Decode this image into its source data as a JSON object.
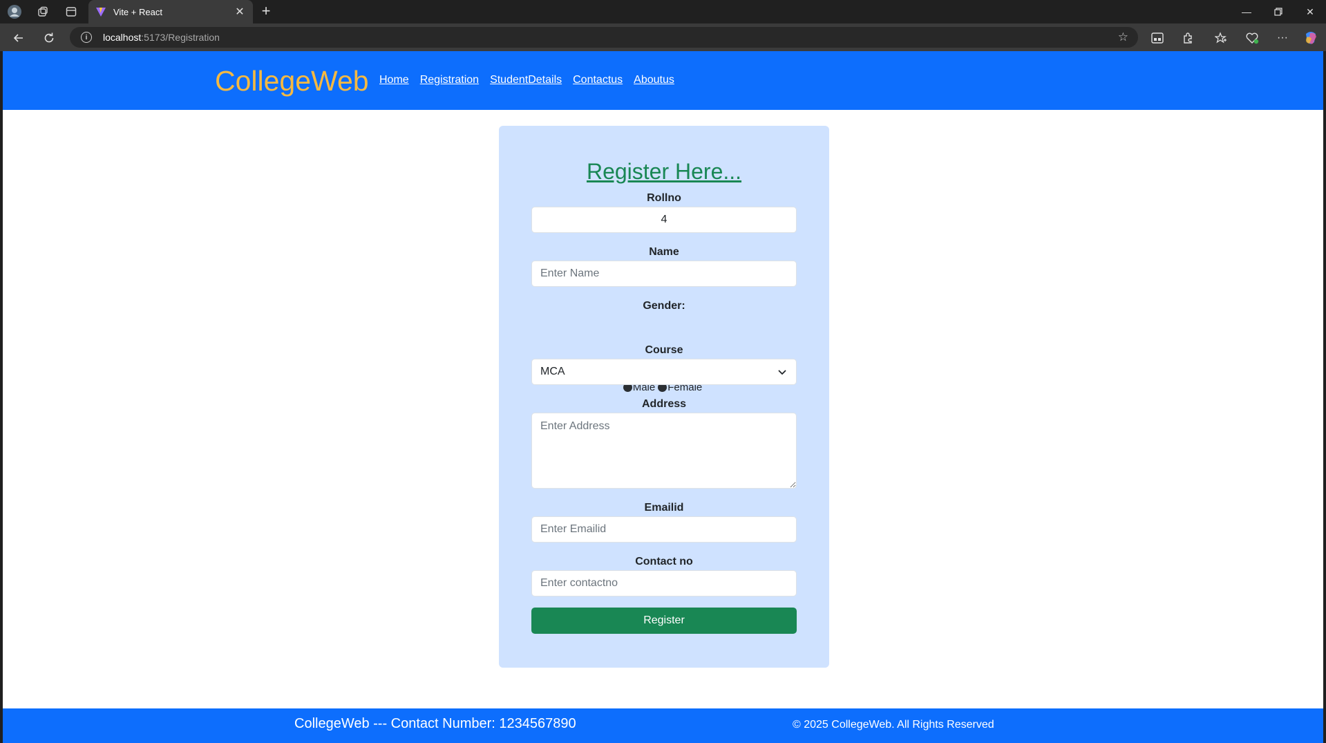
{
  "browser": {
    "tab_title": "Vite + React",
    "url_host": "localhost",
    "url_path": ":5173/Registration"
  },
  "navbar": {
    "brand": "CollegeWeb",
    "links": [
      "Home",
      "Registration",
      "StudentDetails",
      "Contactus",
      "Aboutus"
    ]
  },
  "form": {
    "heading": "Register Here...",
    "rollno": {
      "label": "Rollno",
      "value": "4"
    },
    "name": {
      "label": "Name",
      "placeholder": "Enter Name"
    },
    "gender": {
      "label": "Gender:",
      "options": [
        "Male",
        "Female"
      ]
    },
    "course": {
      "label": "Course",
      "selected": "MCA"
    },
    "address": {
      "label": "Address",
      "placeholder": "Enter Address"
    },
    "email": {
      "label": "Emailid",
      "placeholder": "Enter Emailid"
    },
    "contact": {
      "label": "Contact no",
      "placeholder": "Enter contactno"
    },
    "submit_label": "Register"
  },
  "footer": {
    "left_text": "CollegeWeb --- Contact Number: 1234567890",
    "right_text": "© 2025 CollegeWeb. All Rights Reserved"
  },
  "colors": {
    "navbar_bg": "#0d6efd",
    "brand": "#f5b942",
    "card_bg": "#cfe2ff",
    "accent_green": "#198754"
  }
}
